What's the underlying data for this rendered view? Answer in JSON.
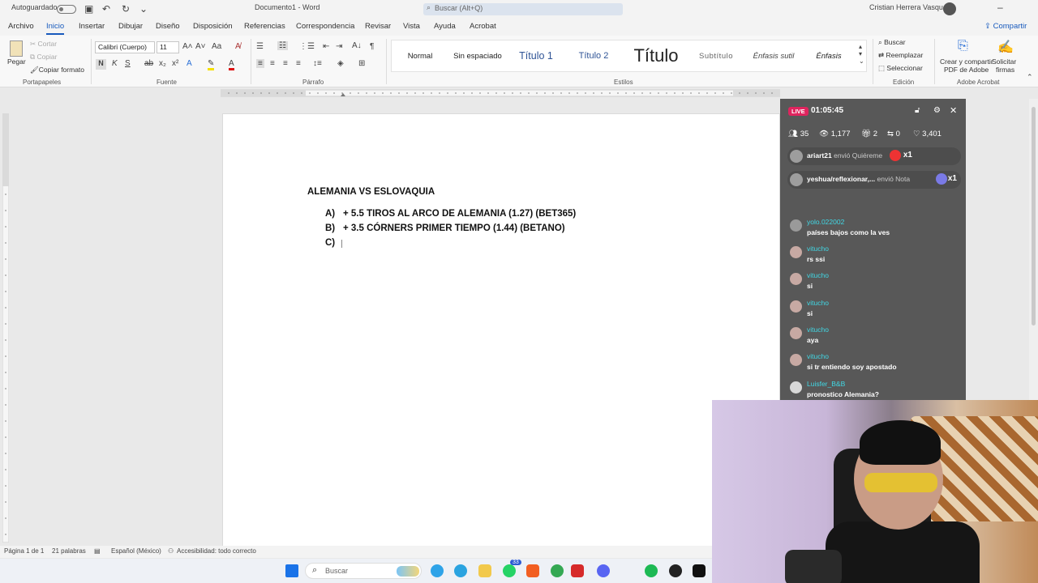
{
  "titlebar": {
    "autosave": "Autoguardado",
    "doc_title": "Documento1 - Word",
    "search_placeholder": "Buscar (Alt+Q)",
    "user": "Cristian Herrera Vasquez"
  },
  "menu": {
    "tabs": [
      "Archivo",
      "Inicio",
      "Insertar",
      "Dibujar",
      "Diseño",
      "Disposición",
      "Referencias",
      "Correspondencia",
      "Revisar",
      "Vista",
      "Ayuda",
      "Acrobat"
    ],
    "active": "Inicio",
    "share": "Compartir"
  },
  "ribbon": {
    "clipboard": {
      "paste": "Pegar",
      "cut": "Cortar",
      "copy": "Copiar",
      "format_painter": "Copiar formato",
      "group": "Portapapeles"
    },
    "font": {
      "name": "Calibri (Cuerpo)",
      "size": "11",
      "group": "Fuente",
      "bold": "N",
      "italic": "K",
      "underline": "S"
    },
    "paragraph": {
      "group": "Párrafo"
    },
    "styles": {
      "items": [
        "Normal",
        "Sin espaciado",
        "Título 1",
        "Título 2",
        "Título",
        "Subtítulo",
        "Énfasis sutil",
        "Énfasis"
      ],
      "group": "Estilos"
    },
    "editing": {
      "find": "Buscar",
      "replace": "Reemplazar",
      "select": "Seleccionar",
      "group": "Edición"
    },
    "acrobat": {
      "create_share_line1": "Crear y compartir",
      "create_share_line2": "PDF de Adobe",
      "request_line1": "Solicitar",
      "request_line2": "firmas",
      "group": "Adobe Acrobat"
    }
  },
  "document": {
    "heading": "ALEMANIA VS ESLOVAQUIA",
    "items": [
      {
        "marker": "A)",
        "text": "+ 5.5 TIROS AL ARCO DE ALEMANIA (1.27) (BET365)"
      },
      {
        "marker": "B)",
        "text": "+ 3.5 CÓRNERS PRIMER TIEMPO (1.44) (BETANO)"
      },
      {
        "marker": "C)",
        "text": ""
      }
    ]
  },
  "statusbar": {
    "page": "Página 1 de 1",
    "words": "21 palabras",
    "language": "Español (México)",
    "accessibility": "Accesibilidad: todo correcto"
  },
  "taskbar": {
    "search": "Buscar",
    "whatsapp_badge": "33"
  },
  "live": {
    "badge": "LIVE",
    "timer": "01:05:45",
    "stats": {
      "members": "35",
      "views": "1,177",
      "gifts": "2",
      "shares": "0",
      "likes": "3,401"
    },
    "gifts": [
      {
        "user": "ariart21",
        "action": "envió Quiéreme",
        "count": "x1"
      },
      {
        "user": "yeshua/reflexionar,...",
        "action": "envió Nota",
        "count": "x1"
      }
    ],
    "chat": [
      {
        "user": "yolo.022002",
        "message": "países bajos como la ves"
      },
      {
        "user": "vitucho",
        "message": "rs ssi"
      },
      {
        "user": "vitucho",
        "message": "si"
      },
      {
        "user": "vitucho",
        "message": "si"
      },
      {
        "user": "vitucho",
        "message": "aya"
      },
      {
        "user": "vitucho",
        "message": "si tr entiendo soy apostado"
      },
      {
        "user": "Luisfer_B&B",
        "message": "pronostico Alemania?"
      }
    ]
  }
}
